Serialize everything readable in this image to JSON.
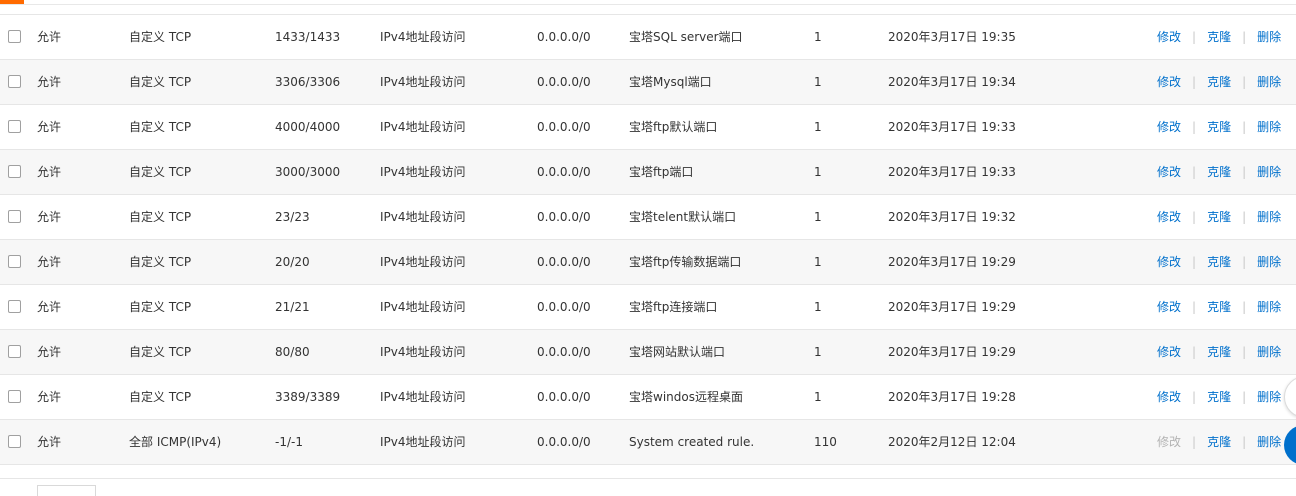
{
  "colors": {
    "accent": "#ff6a00",
    "link": "#0070cc",
    "disabled_link": "#b3b3b3",
    "float_button": "#0070cc"
  },
  "actions": {
    "modify": "修改",
    "clone": "克隆",
    "delete": "删除",
    "separator": "|"
  },
  "rows": [
    {
      "auth": "允许",
      "protocol": "自定义 TCP",
      "port": "1433/1433",
      "type": "IPv4地址段访问",
      "source": "0.0.0.0/0",
      "desc": "宝塔SQL server端口",
      "priority": "1",
      "created": "2020年3月17日 19:35",
      "modify_enabled": true
    },
    {
      "auth": "允许",
      "protocol": "自定义 TCP",
      "port": "3306/3306",
      "type": "IPv4地址段访问",
      "source": "0.0.0.0/0",
      "desc": "宝塔Mysql端口",
      "priority": "1",
      "created": "2020年3月17日 19:34",
      "modify_enabled": true
    },
    {
      "auth": "允许",
      "protocol": "自定义 TCP",
      "port": "4000/4000",
      "type": "IPv4地址段访问",
      "source": "0.0.0.0/0",
      "desc": "宝塔ftp默认端口",
      "priority": "1",
      "created": "2020年3月17日 19:33",
      "modify_enabled": true
    },
    {
      "auth": "允许",
      "protocol": "自定义 TCP",
      "port": "3000/3000",
      "type": "IPv4地址段访问",
      "source": "0.0.0.0/0",
      "desc": "宝塔ftp端口",
      "priority": "1",
      "created": "2020年3月17日 19:33",
      "modify_enabled": true
    },
    {
      "auth": "允许",
      "protocol": "自定义 TCP",
      "port": "23/23",
      "type": "IPv4地址段访问",
      "source": "0.0.0.0/0",
      "desc": "宝塔telent默认端口",
      "priority": "1",
      "created": "2020年3月17日 19:32",
      "modify_enabled": true
    },
    {
      "auth": "允许",
      "protocol": "自定义 TCP",
      "port": "20/20",
      "type": "IPv4地址段访问",
      "source": "0.0.0.0/0",
      "desc": "宝塔ftp传输数据端口",
      "priority": "1",
      "created": "2020年3月17日 19:29",
      "modify_enabled": true
    },
    {
      "auth": "允许",
      "protocol": "自定义 TCP",
      "port": "21/21",
      "type": "IPv4地址段访问",
      "source": "0.0.0.0/0",
      "desc": "宝塔ftp连接端口",
      "priority": "1",
      "created": "2020年3月17日 19:29",
      "modify_enabled": true
    },
    {
      "auth": "允许",
      "protocol": "自定义 TCP",
      "port": "80/80",
      "type": "IPv4地址段访问",
      "source": "0.0.0.0/0",
      "desc": "宝塔网站默认端口",
      "priority": "1",
      "created": "2020年3月17日 19:29",
      "modify_enabled": true
    },
    {
      "auth": "允许",
      "protocol": "自定义 TCP",
      "port": "3389/3389",
      "type": "IPv4地址段访问",
      "source": "0.0.0.0/0",
      "desc": "宝塔windos远程桌面",
      "priority": "1",
      "created": "2020年3月17日 19:28",
      "modify_enabled": true
    },
    {
      "auth": "允许",
      "protocol": "全部 ICMP(IPv4)",
      "port": "-1/-1",
      "type": "IPv4地址段访问",
      "source": "0.0.0.0/0",
      "desc": "System created rule.",
      "priority": "110",
      "created": "2020年2月12日 12:04",
      "modify_enabled": false
    }
  ]
}
